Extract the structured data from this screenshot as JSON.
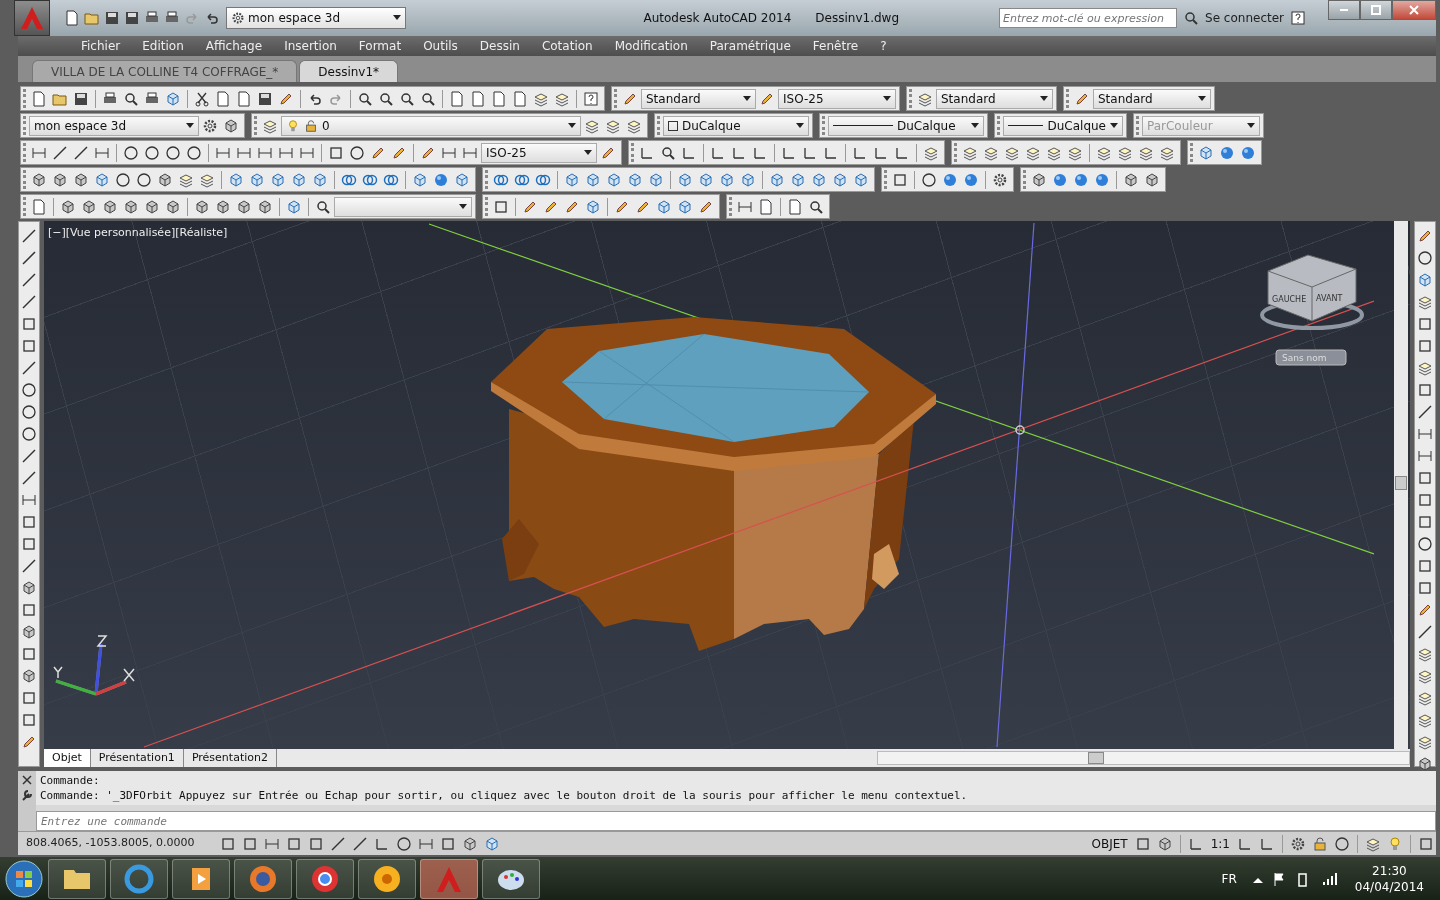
{
  "title_bar": {
    "workspace": "mon espace 3d",
    "app_name": "Autodesk AutoCAD 2014",
    "file_name": "Dessinv1.dwg",
    "search": {
      "placeholder": "Entrez mot-clé ou expression"
    },
    "sign_in": "Se connecter"
  },
  "menu": [
    "Fichier",
    "Edition",
    "Affichage",
    "Insertion",
    "Format",
    "Outils",
    "Dessin",
    "Cotation",
    "Modification",
    "Paramétrique",
    "Fenêtre",
    "?"
  ],
  "documents": [
    {
      "label": "VILLA DE LA COLLINE T4 COFFRAGE_*",
      "selected": false
    },
    {
      "label": "Dessinv1*",
      "selected": true
    }
  ],
  "toolbars": {
    "text_style": "Standard",
    "dim_style": "ISO-25",
    "table_style": "Standard",
    "multileader_style": "Standard",
    "workspace": "mon espace 3d",
    "layer": "0",
    "object_color": "DuCalque",
    "linetype": "DuCalque",
    "lineweight": "DuCalque",
    "plot_style": {
      "value": "ParCouleur",
      "disabled": true
    },
    "dim_style_current": "ISO-25"
  },
  "viewport": {
    "label": "[−][Vue personnalisée][Réaliste]",
    "viewcube": {
      "left": "GAUCHE",
      "front": "AVANT",
      "ucs": "Sans nom"
    }
  },
  "layout_tabs": [
    {
      "label": "Objet",
      "selected": true
    },
    {
      "label": "Présentation1",
      "selected": false
    },
    {
      "label": "Présentation2",
      "selected": false
    }
  ],
  "command": {
    "history": [
      "Commande:",
      "Commande: '_3DFOrbit Appuyez sur Entrée ou Echap pour sortir, ou cliquez avec le bouton droit de la souris pour afficher le menu contextuel."
    ],
    "placeholder": "Entrez une commande"
  },
  "status_bar": {
    "coordinates": "808.4065, -1053.8005, 0.0000",
    "space": "OBJET",
    "scale": "1:1"
  },
  "taskbar": {
    "language": "FR",
    "time": "21:30",
    "date": "04/04/2014"
  }
}
